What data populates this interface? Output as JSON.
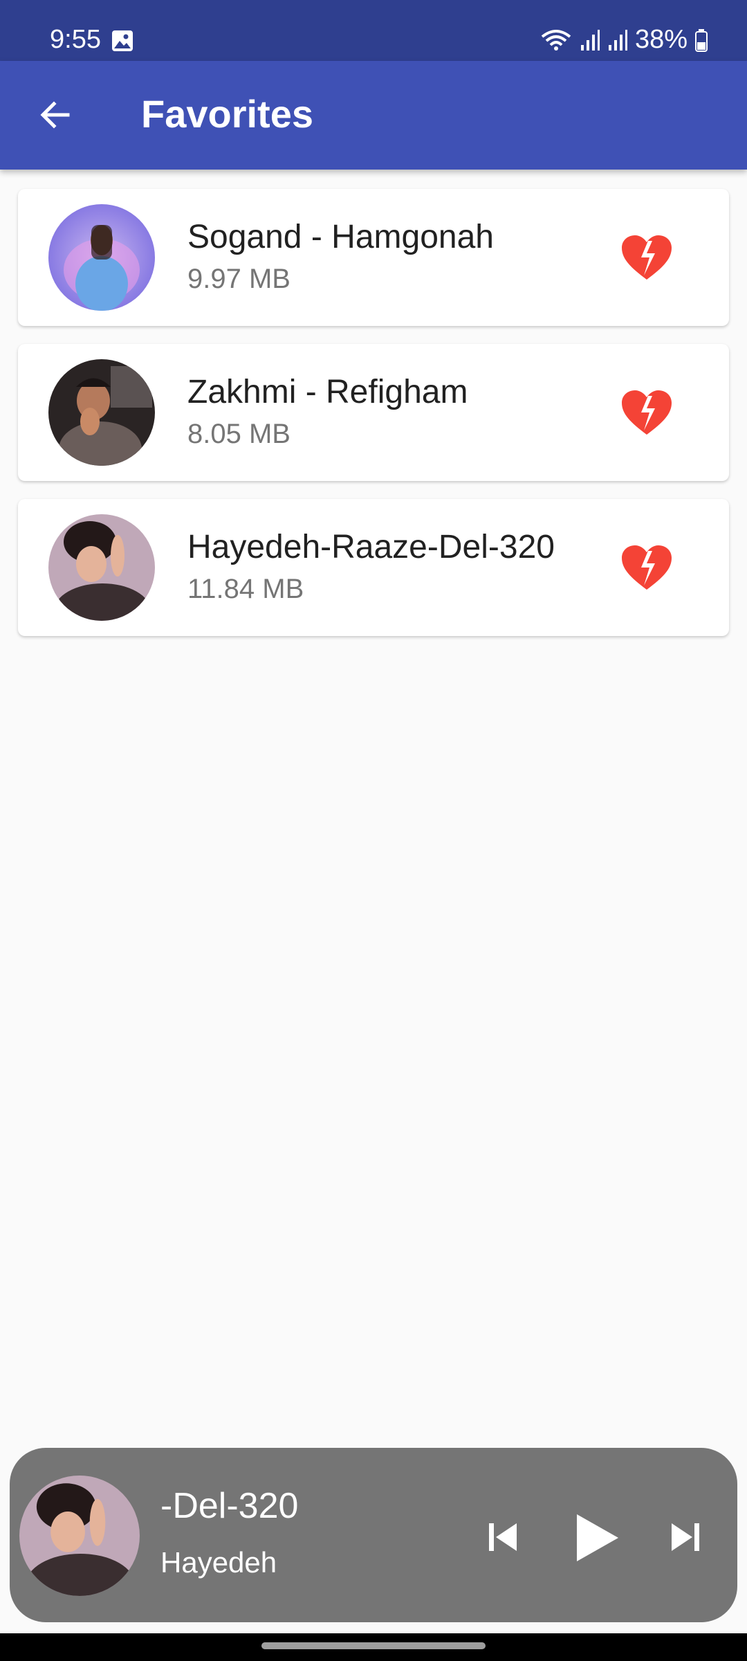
{
  "status_bar": {
    "time": "9:55",
    "battery": "38%",
    "icons": [
      "image-icon",
      "wifi-icon",
      "signal-icon",
      "signal-icon",
      "battery-icon"
    ]
  },
  "app_bar": {
    "title": "Favorites",
    "back_icon": "arrow-left-icon",
    "color": "#3f51b5"
  },
  "favorites": [
    {
      "title": "Sogand - Hamgonah",
      "size": "9.97 MB",
      "action_icon": "broken-heart-icon"
    },
    {
      "title": "Zakhmi - Refigham",
      "size": "8.05 MB",
      "action_icon": "broken-heart-icon"
    },
    {
      "title": "Hayedeh-Raaze-Del-320",
      "size": "11.84 MB",
      "action_icon": "broken-heart-icon"
    }
  ],
  "mini_player": {
    "title": "-Del-320",
    "artist": "Hayedeh",
    "controls": [
      "skip-previous-icon",
      "play-icon",
      "skip-next-icon"
    ]
  },
  "colors": {
    "accent": "#3f51b5",
    "status_bar": "#2f3f8f",
    "heart": "#f44336",
    "player_bg": "#757575"
  }
}
